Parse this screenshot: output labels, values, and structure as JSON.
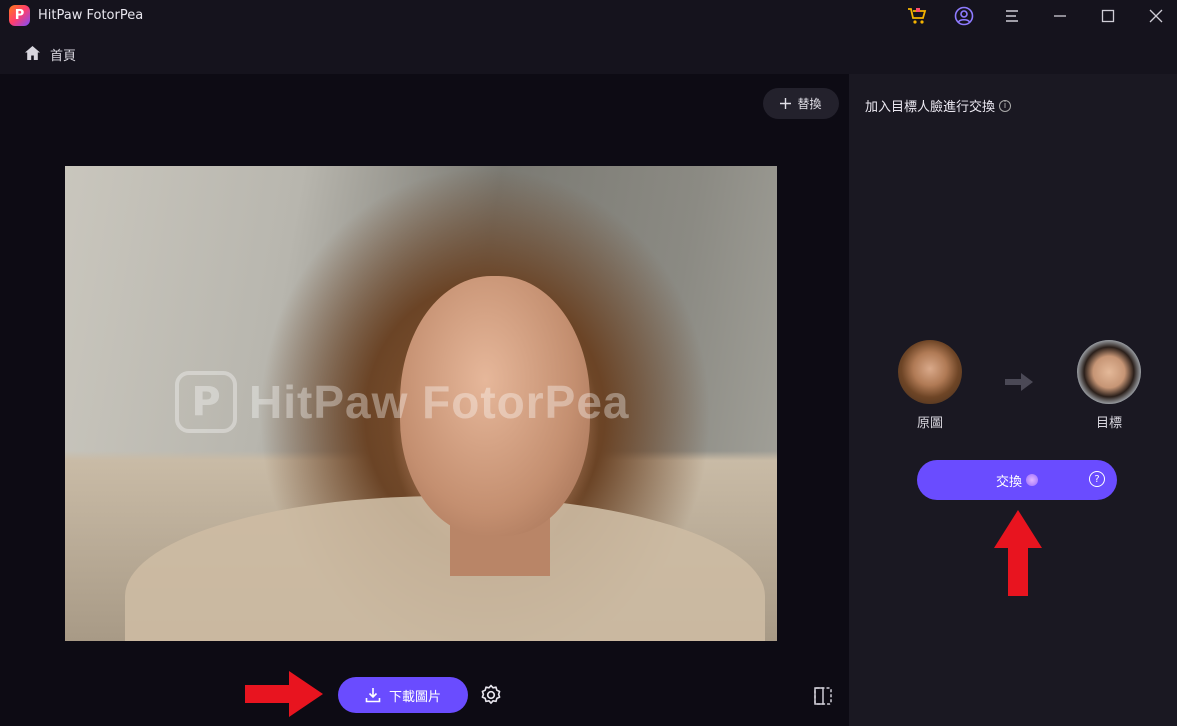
{
  "titlebar": {
    "app_name": "HitPaw FotorPea",
    "logo_letter": "P",
    "icons": [
      "cart-icon",
      "account-icon",
      "menu-icon",
      "minimize-icon",
      "maximize-icon",
      "close-icon"
    ]
  },
  "nav": {
    "home_label": "首頁"
  },
  "canvas": {
    "replace_label": "替換",
    "watermark_text": "HitPaw FotorPea",
    "download_label": "下載圖片"
  },
  "panel": {
    "title": "加入目標人臉進行交換",
    "source_label": "原圖",
    "target_label": "目標",
    "swap_label": "交換",
    "swap_help": "?"
  },
  "colors": {
    "accent": "#6a4cff",
    "annotation_arrow": "#e8141f",
    "titlebar_bg": "#15131d",
    "panel_bg": "#1a1822"
  }
}
